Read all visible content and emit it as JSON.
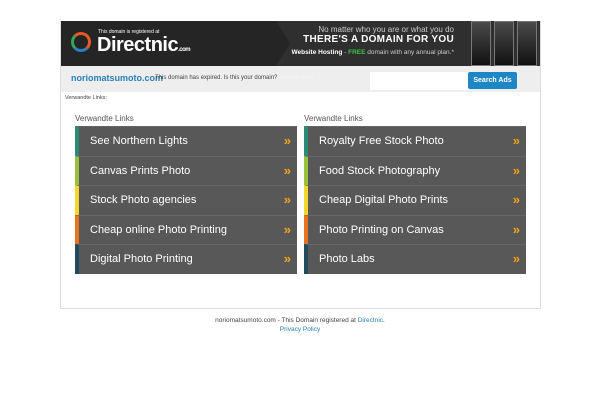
{
  "banner": {
    "registered_text": "This domain is registered at",
    "brand": "Directnic",
    "brand_suffix": ".com",
    "tagline1": "No matter who you are or what you do",
    "tagline2": "THERE'S A DOMAIN FOR YOU",
    "hosting": "Website Hosting",
    "dash": " - ",
    "free": "FREE",
    "hosting_rest": " domain with any annual plan.*"
  },
  "bar": {
    "domain": "noriomatsumoto.com",
    "expired": "This domain has expired. Is this your domain?",
    "renew": "Renew Now",
    "search_placeholder": "",
    "search_button": "Search Ads"
  },
  "related_label": "Verwandte Links:",
  "columns": [
    {
      "heading": "Verwandte Links",
      "items": [
        "See Northern Lights",
        "Canvas Prints Photo",
        "Stock Photo agencies",
        "Cheap online Photo Printing",
        "Digital Photo Printing"
      ]
    },
    {
      "heading": "Verwandte Links",
      "items": [
        "Royalty Free Stock Photo",
        "Food Stock Photography",
        "Cheap Digital Photo Prints",
        "Photo Printing on Canvas",
        "Photo Labs"
      ]
    }
  ],
  "accent_colors": [
    "#2a8a76",
    "#9ac13c",
    "#f3d52b",
    "#e8731f",
    "#1f4b5a"
  ],
  "chevron": "»",
  "footer": {
    "text": "noriomatsumoto.com - This Domain registered at ",
    "link": "Directnic",
    "period": ".",
    "privacy": "Privacy Policy"
  }
}
